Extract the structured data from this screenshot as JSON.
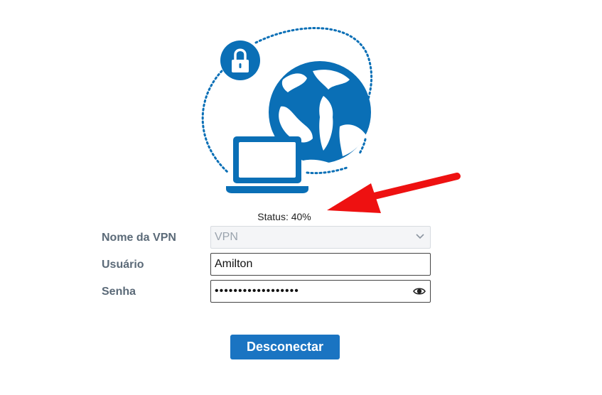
{
  "status": {
    "label": "Status: 40%",
    "progress_percent": 40
  },
  "form": {
    "vpn_name": {
      "label": "Nome da VPN",
      "selected": "VPN",
      "disabled": true
    },
    "user": {
      "label": "Usuário",
      "value": "Amilton"
    },
    "password": {
      "label": "Senha",
      "masked_value": "••••••••••••••••••"
    }
  },
  "actions": {
    "disconnect_label": "Desconectar"
  },
  "icons": {
    "illustration": "vpn-laptop-globe-lock-illustration",
    "lock": "lock-icon",
    "globe": "globe-icon",
    "laptop": "laptop-icon",
    "chevron": "chevron-down-icon",
    "eye": "eye-icon",
    "annotation": "red-arrow-annotation"
  },
  "colors": {
    "brand_blue": "#0a6fb6",
    "button_blue": "#1a74c2",
    "label_gray": "#5b6a78",
    "annotation_red": "#ee1111"
  }
}
